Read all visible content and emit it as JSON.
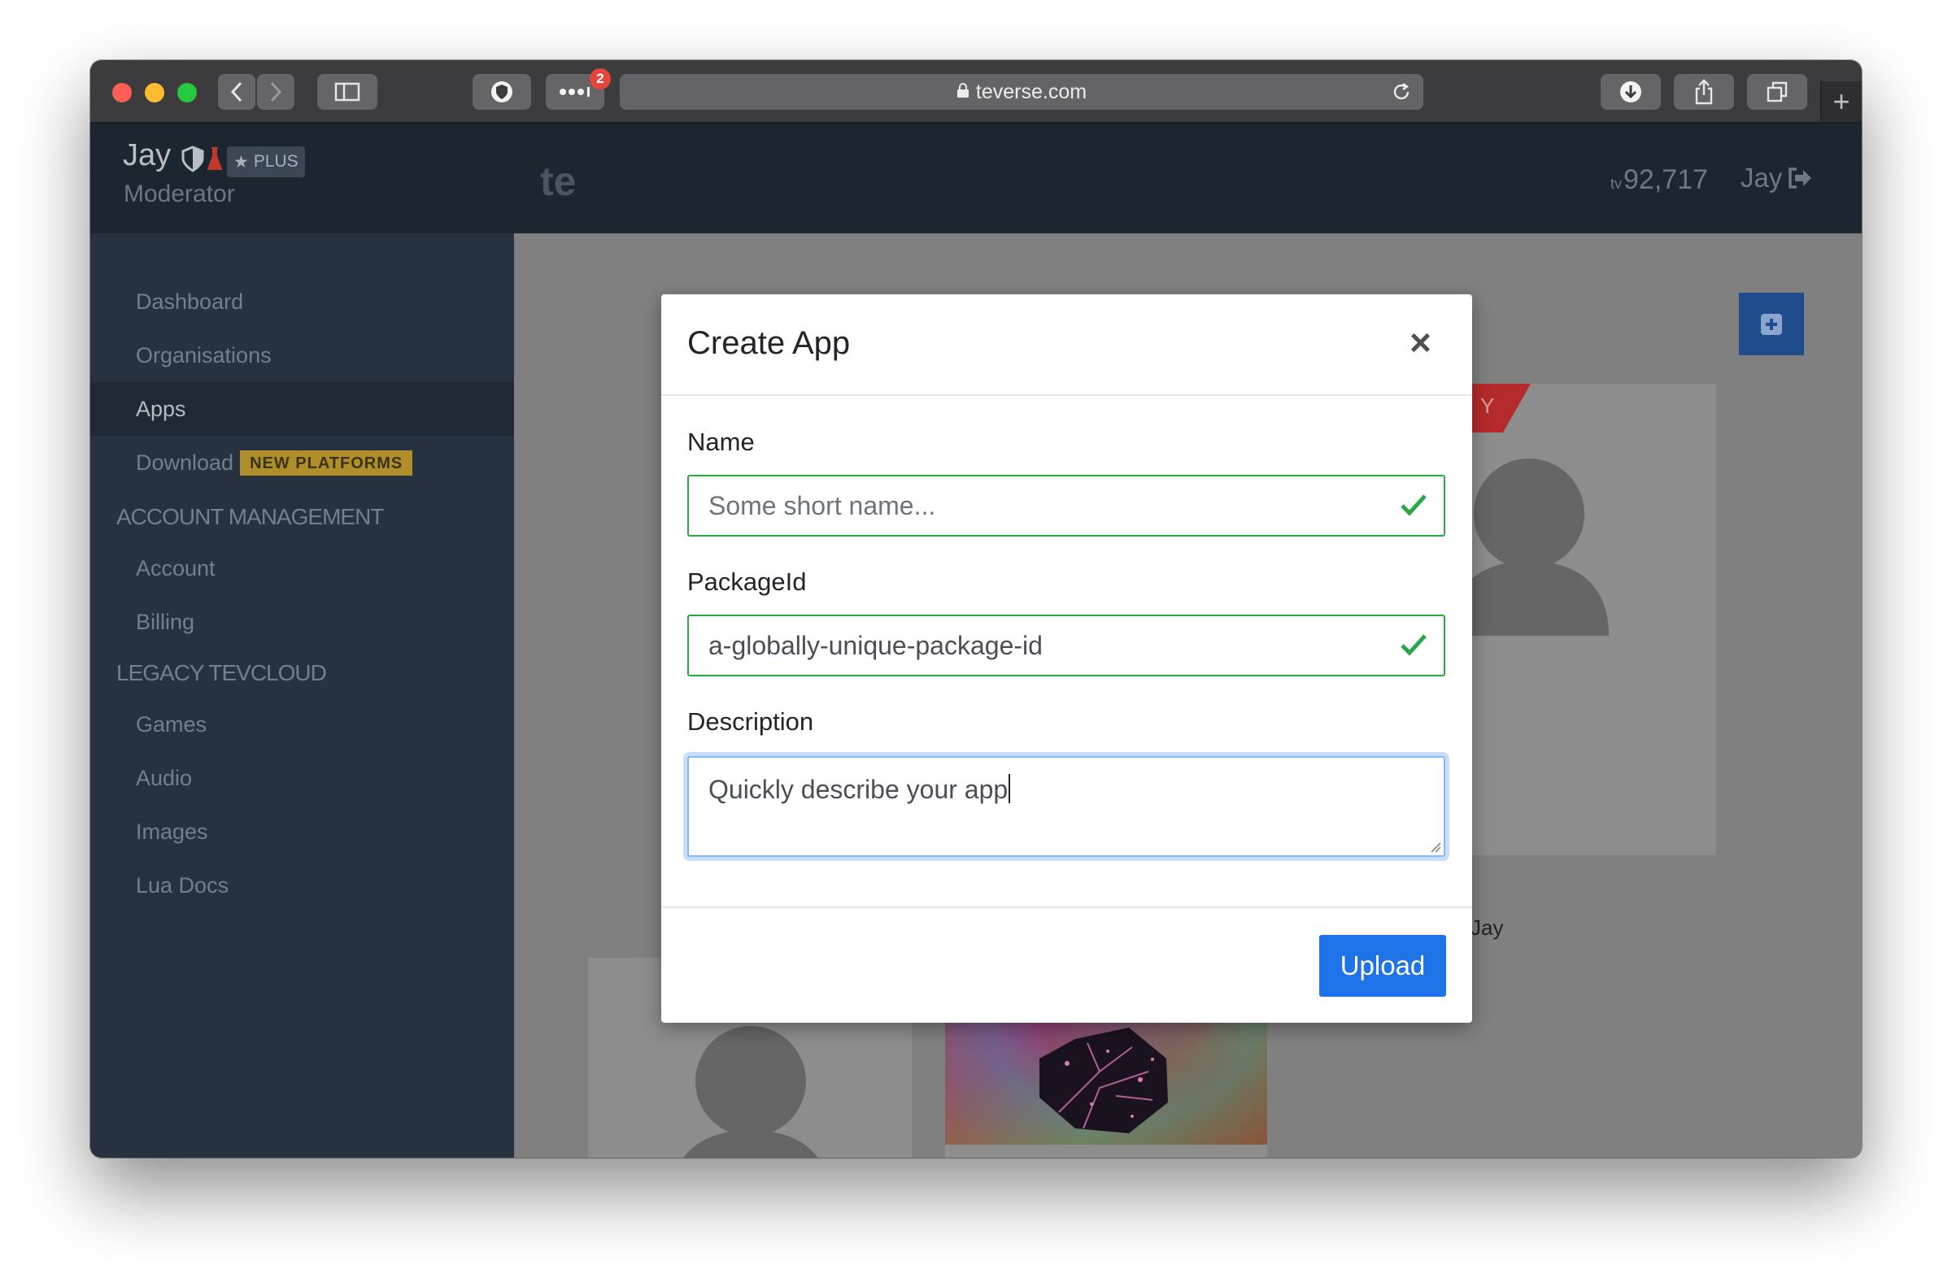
{
  "browser": {
    "url": "teverse.com",
    "tab_badge_count": "2"
  },
  "sidebar": {
    "user": {
      "name": "Jay",
      "plan": "PLUS",
      "role": "Moderator"
    },
    "items": [
      {
        "label": "Dashboard"
      },
      {
        "label": "Organisations"
      },
      {
        "label": "Apps"
      },
      {
        "label": "Download",
        "badge": "NEW PLATFORMS"
      }
    ],
    "account_section": {
      "title": "ACCOUNT MANAGEMENT",
      "items": [
        {
          "label": "Account"
        },
        {
          "label": "Billing"
        }
      ]
    },
    "legacy_section": {
      "title": "LEGACY TEVCLOUD",
      "items": [
        {
          "label": "Games"
        },
        {
          "label": "Audio"
        },
        {
          "label": "Images"
        },
        {
          "label": "Lua Docs"
        }
      ]
    }
  },
  "topbar": {
    "brand": "te",
    "currency_prefix": "tv",
    "balance": "92,717",
    "user": "Jay"
  },
  "background_card": {
    "ribbon_text": "Y",
    "owner": "Jay"
  },
  "modal": {
    "title": "Create App",
    "close": "×",
    "name_label": "Name",
    "name_value": "Some short name...",
    "package_label": "PackageId",
    "package_value": "a-globally-unique-package-id",
    "description_label": "Description",
    "description_value": "Quickly describe your app",
    "submit": "Upload"
  },
  "colors": {
    "accent": "#1e73e8",
    "valid": "#28a745",
    "sidebar": "#263240",
    "ribbon": "#b52a2a"
  }
}
